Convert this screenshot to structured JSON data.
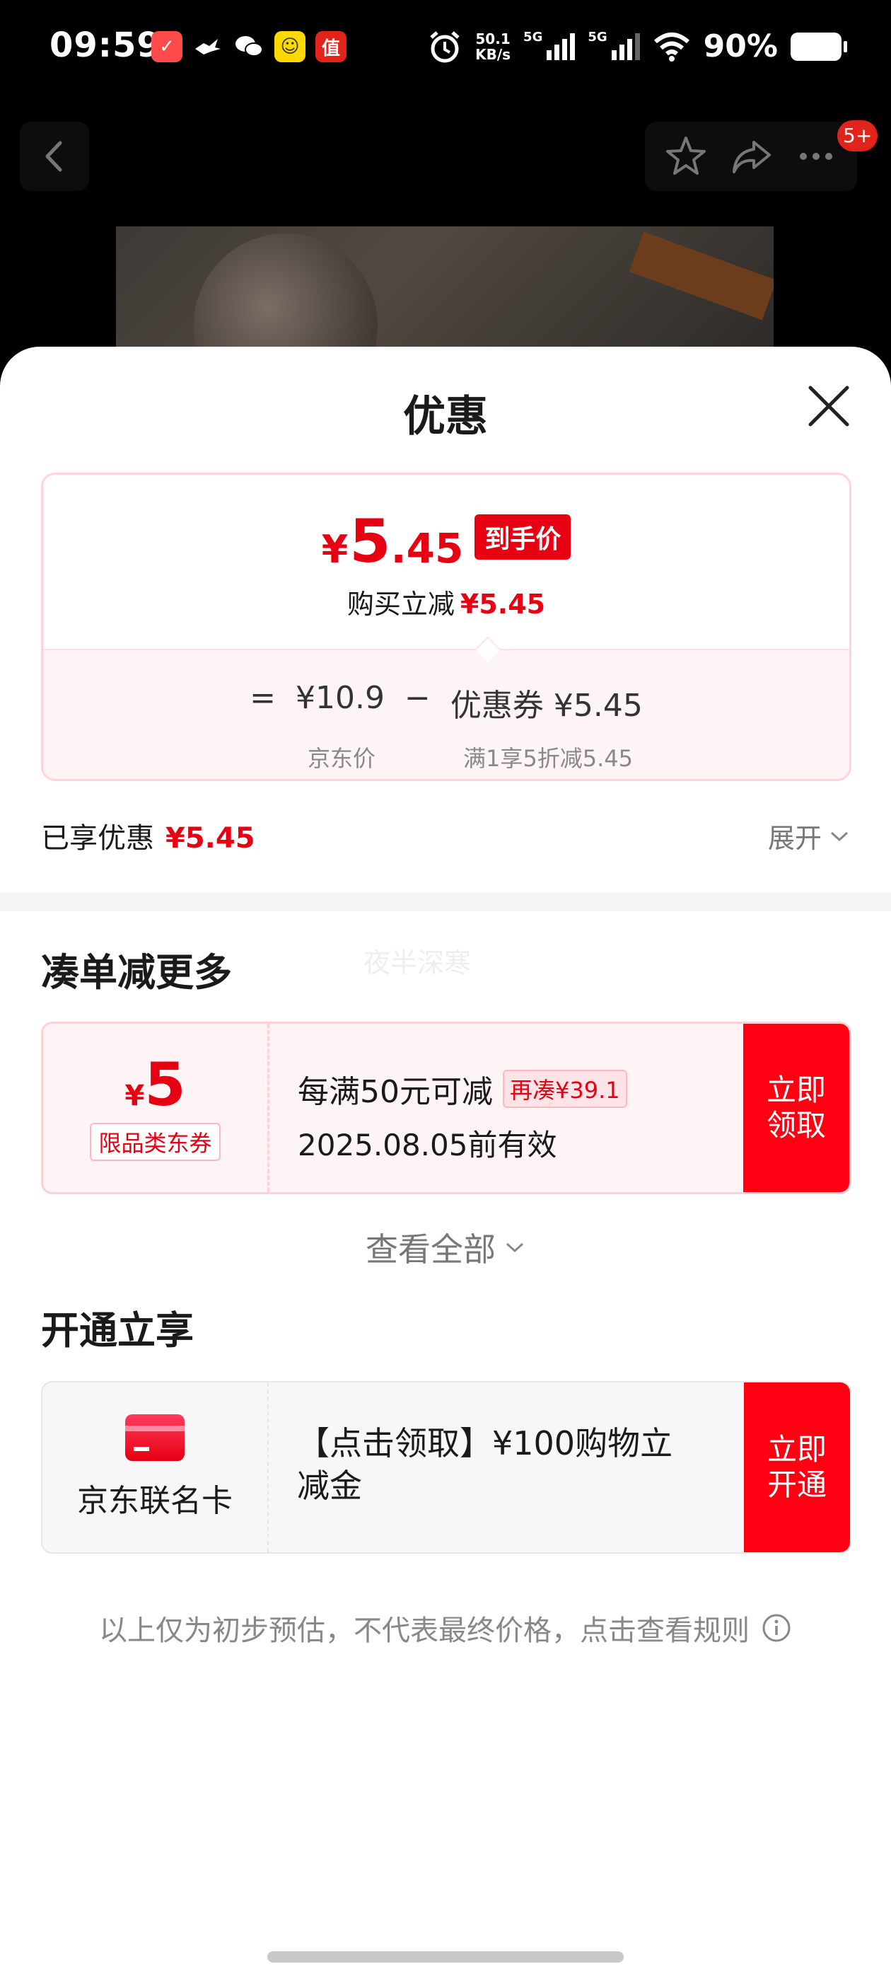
{
  "status_bar": {
    "time": "09:59",
    "network_speed_value": "50.1",
    "network_speed_unit": "KB/s",
    "sim1_label": "5G",
    "sim2_label": "5G",
    "battery": "90%",
    "apps": [
      {
        "icon": "app-delivery-icon",
        "color": "#ff4b4b",
        "glyph": "✓"
      },
      {
        "icon": "bird-app-icon",
        "color": "transparent",
        "glyph": "🕊"
      },
      {
        "icon": "wechat-icon",
        "color": "transparent",
        "glyph": "💬"
      },
      {
        "icon": "app-yellow-icon",
        "color": "#ffd800",
        "glyph": "☺"
      },
      {
        "icon": "app-zhi-icon",
        "color": "#e2231a",
        "glyph": "值"
      }
    ]
  },
  "nav": {
    "badge": "5+"
  },
  "sheet": {
    "title": "优惠"
  },
  "price_card": {
    "currency": "¥",
    "price_int": "5",
    "price_dec": ".45",
    "final_tag": "到手价",
    "sub_text": "购买立减",
    "sub_amount": "¥5.45",
    "formula_eq": "=",
    "formula_base": "¥10.9",
    "formula_minus": "−",
    "formula_coupon": "优惠券 ¥5.45",
    "base_label": "京东价",
    "coupon_label": "满1享5折减5.45"
  },
  "enjoyed": {
    "label": "已享优惠",
    "amount": "¥5.45",
    "expand_label": "展开"
  },
  "section_more": {
    "title": "凑单减更多",
    "watermark": "夜半深寒"
  },
  "coupon": {
    "currency": "¥",
    "amount": "5",
    "scope": "限品类东券",
    "rule": "每满50元可减",
    "chip": "再凑¥39.1",
    "valid": "2025.08.05前有效",
    "button": "立即\n领取"
  },
  "view_all": "查看全部",
  "section_open": {
    "title": "开通立享"
  },
  "card_offer": {
    "name": "京东联名卡",
    "benefit": "【点击领取】¥100购物立减金",
    "button": "立即\n开通"
  },
  "disclaimer": "以上仅为初步预估，不代表最终价格，点击查看规则"
}
